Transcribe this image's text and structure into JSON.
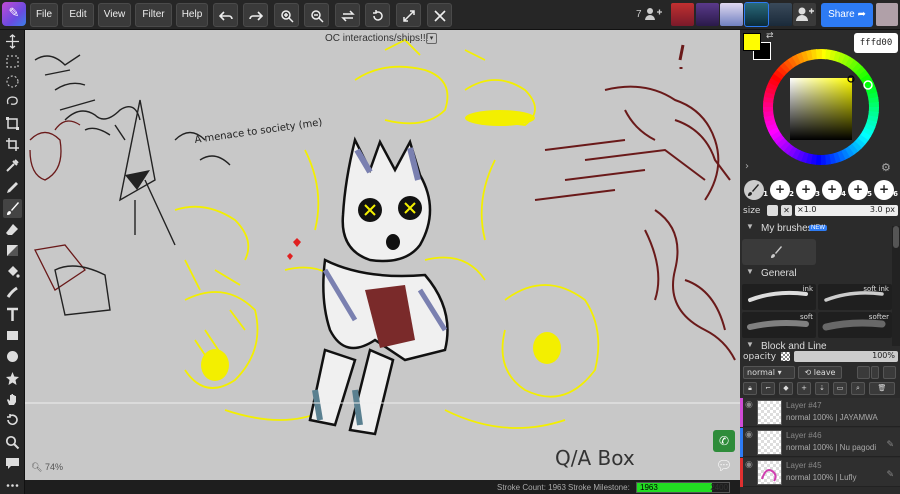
{
  "menu": {
    "file": "File",
    "edit": "Edit",
    "view": "View",
    "filter": "Filter",
    "help": "Help"
  },
  "users_count": "7",
  "share_label": "Share",
  "document_title": "OC interactions/ships!!!",
  "zoom_label": "74%",
  "status": {
    "stroke_count_label": "Stroke Count: 1963",
    "milestone_label": "Stroke Milestone:",
    "milestone_value": "1963",
    "milestone_target": "2400",
    "milestone_progress": 0.818
  },
  "color": {
    "hex": "fffd00",
    "primary": "#fffd00",
    "secondary": "#000000"
  },
  "brush_slots": [
    "1",
    "2",
    "3",
    "4",
    "5",
    "6"
  ],
  "size": {
    "label": "size",
    "multiplier": "×1.0",
    "value": "3.0 px"
  },
  "sections": {
    "my_brushes": "My brushes",
    "new_badge": "NEW",
    "general": "General",
    "block_and_line": "Block and Line"
  },
  "brushes": [
    {
      "label": "ink"
    },
    {
      "label": "soft ink"
    },
    {
      "label": "soft"
    },
    {
      "label": "softer"
    }
  ],
  "layer_controls": {
    "opacity_label": "opacity",
    "opacity_value": "100%",
    "blend_mode": "normal",
    "leave_label": "leave"
  },
  "layers": [
    {
      "name": "Layer #47",
      "meta": "normal 100% | JAYAMWA",
      "color": "#d14bd6"
    },
    {
      "name": "Layer #46",
      "meta": "normal 100% | Nu pagodi",
      "color": "#2d7bf4"
    },
    {
      "name": "Layer #45",
      "meta": "normal 100% | Lufly",
      "color": "#e03030"
    }
  ],
  "canvas_text": {
    "q_a_box": "Q/A  Box",
    "menace": "A menace to society (me)"
  }
}
